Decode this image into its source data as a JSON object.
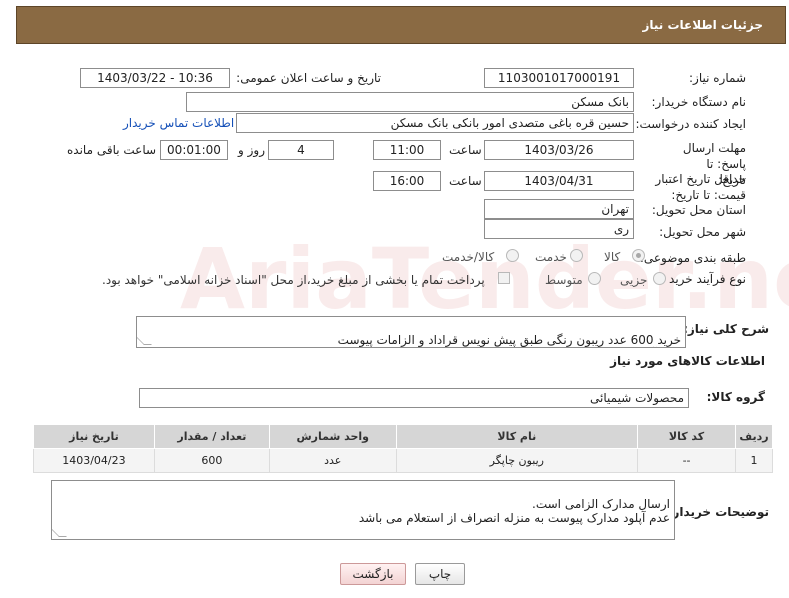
{
  "header": {
    "title": "جزئیات اطلاعات نیاز"
  },
  "watermark": "AriaTender.neT",
  "form": {
    "need_number_label": "شماره نیاز:",
    "need_number": "1103001017000191",
    "announce_label": "تاریخ و ساعت اعلان عمومی:",
    "announce_value": "1403/03/22 - 10:36",
    "buyer_org_label": "نام دستگاه خریدار:",
    "buyer_org": "بانک مسکن",
    "requester_label": "ایجاد کننده درخواست:",
    "requester": "حسین  قره باغی متصدی امور بانکی بانک مسکن",
    "contact_link": "اطلاعات تماس خریدار",
    "deadline_label": "مهلت ارسال پاسخ: تا تاریخ:",
    "deadline_date": "1403/03/26",
    "time_label": "ساعت",
    "deadline_time": "11:00",
    "days_value": "4",
    "days_label": "روز و",
    "remaining_time": "00:01:00",
    "remaining_label": "ساعت باقی مانده",
    "validity_label": "حداقل تاریخ اعتبار قیمت: تا تاریخ:",
    "validity_date": "1403/04/31",
    "validity_time_label": "ساعت",
    "validity_time": "16:00",
    "province_label": "استان محل تحویل:",
    "province": "تهران",
    "city_label": "شهر محل تحویل:",
    "city": "ری",
    "category_label": "طبقه بندی موضوعی:",
    "category_options": [
      "کالا",
      "خدمت",
      "کالا/خدمت"
    ],
    "process_label": "نوع فرآیند خرید :",
    "process_options": [
      "جزیی",
      "متوسط"
    ],
    "payment_note": "پرداخت تمام یا بخشی از مبلغ خرید،از محل \"اسناد خزانه اسلامی\" خواهد بود.",
    "description_label": "شرح کلی نیاز:",
    "description": "خرید 600 عدد ریبون رنگی طبق پیش نویس قراداد و الزامات پیوست\nعدم آپلود مدارک پیوست به منزله انصراف از استعلام می باشد"
  },
  "goods": {
    "section_title": "اطلاعات کالاهای مورد نیاز",
    "group_label": "گروه کالا:",
    "group_value": "محصولات شیمیائی",
    "columns": [
      "ردیف",
      "کد کالا",
      "نام کالا",
      "واحد شمارش",
      "تعداد / مقدار",
      "تاریخ نیاز"
    ],
    "rows": [
      [
        "1",
        "--",
        "ریبون چاپگر",
        "عدد",
        "600",
        "1403/04/23"
      ]
    ]
  },
  "buyer_notes_label": "توضیحات خریدار:",
  "buyer_notes": "ارسال مدارک الزامی است.\nعدم آپلود مدارک پیوست به منزله انصراف از استعلام می باشد",
  "buttons": {
    "print": "چاپ",
    "back": "بازگشت"
  }
}
